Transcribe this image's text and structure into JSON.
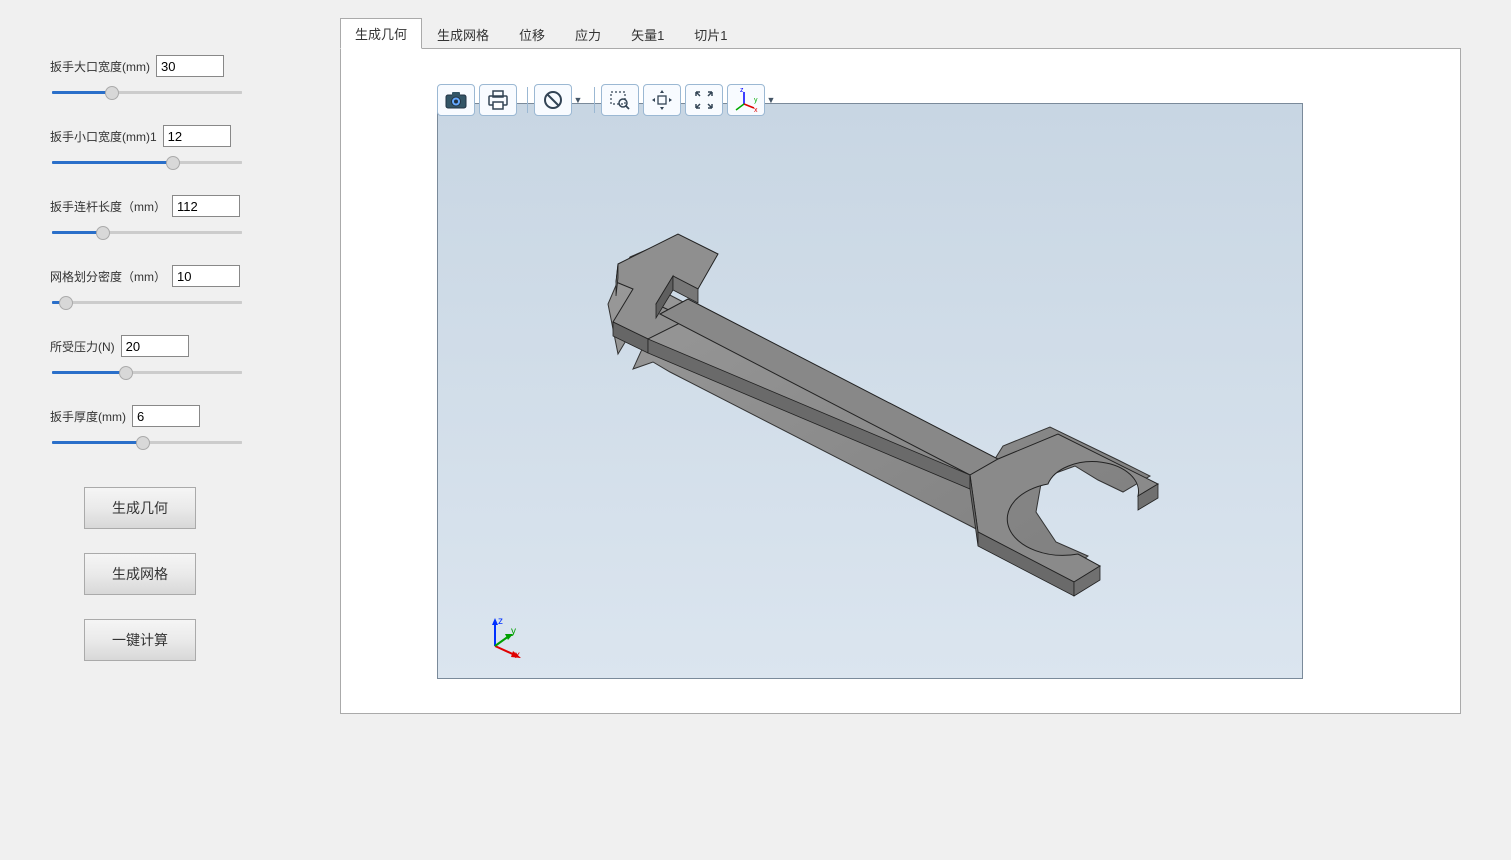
{
  "params": [
    {
      "id": "large-opening",
      "label": "扳手大口宽度(mm)",
      "value": "30",
      "slider_fill": 30
    },
    {
      "id": "small-opening",
      "label": "扳手小口宽度(mm)1",
      "value": "12",
      "slider_fill": 65
    },
    {
      "id": "rod-length",
      "label": "扳手连杆长度（mm）",
      "value": "112",
      "slider_fill": 25
    },
    {
      "id": "mesh-density",
      "label": "网格划分密度（mm）",
      "value": "10",
      "slider_fill": 4
    },
    {
      "id": "pressure",
      "label": "所受压力(N)",
      "value": "20",
      "slider_fill": 38
    },
    {
      "id": "thickness",
      "label": "扳手厚度(mm)",
      "value": "6",
      "slider_fill": 48
    }
  ],
  "buttons": {
    "gen_geometry": "生成几何",
    "gen_mesh": "生成网格",
    "compute_all": "一键计算"
  },
  "tabs": [
    {
      "id": "tab-geometry",
      "label": "生成几何",
      "active": true
    },
    {
      "id": "tab-mesh",
      "label": "生成网格",
      "active": false
    },
    {
      "id": "tab-disp",
      "label": "位移",
      "active": false
    },
    {
      "id": "tab-stress",
      "label": "应力",
      "active": false
    },
    {
      "id": "tab-vector1",
      "label": "矢量1",
      "active": false
    },
    {
      "id": "tab-slice1",
      "label": "切片1",
      "active": false
    }
  ],
  "axis": {
    "x": "x",
    "y": "y",
    "z": "z"
  },
  "toolbar_icons": [
    "camera-icon",
    "print-icon",
    "",
    "prohibit-icon",
    "dd",
    "",
    "zoom-window-icon",
    "pan-icon",
    "zoom-extents-icon",
    "axis-select-icon",
    "dd"
  ]
}
